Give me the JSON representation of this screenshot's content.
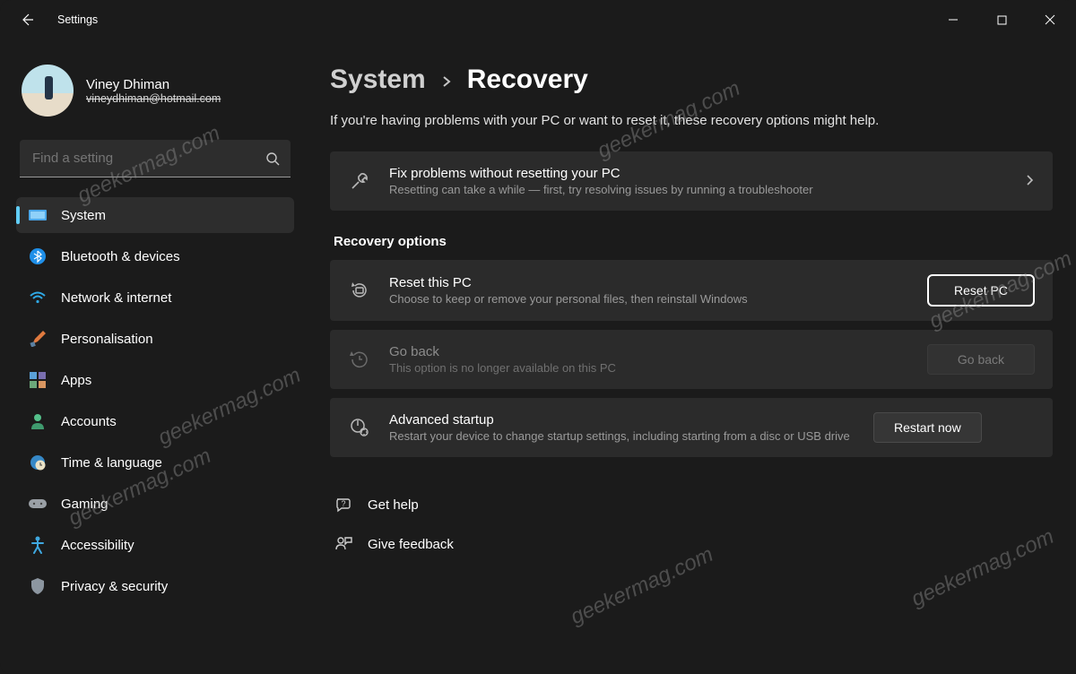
{
  "window": {
    "title": "Settings"
  },
  "profile": {
    "name": "Viney Dhiman",
    "email": "vineydhiman@hotmail.com"
  },
  "search": {
    "placeholder": "Find a setting"
  },
  "sidebar": {
    "items": [
      {
        "id": "system",
        "label": "System",
        "active": true
      },
      {
        "id": "bluetooth",
        "label": "Bluetooth & devices",
        "active": false
      },
      {
        "id": "network",
        "label": "Network & internet",
        "active": false
      },
      {
        "id": "personal",
        "label": "Personalisation",
        "active": false
      },
      {
        "id": "apps",
        "label": "Apps",
        "active": false
      },
      {
        "id": "accounts",
        "label": "Accounts",
        "active": false
      },
      {
        "id": "time",
        "label": "Time & language",
        "active": false
      },
      {
        "id": "gaming",
        "label": "Gaming",
        "active": false
      },
      {
        "id": "accessibility",
        "label": "Accessibility",
        "active": false
      },
      {
        "id": "privacy",
        "label": "Privacy & security",
        "active": false
      }
    ]
  },
  "breadcrumb": {
    "parent": "System",
    "current": "Recovery"
  },
  "page_desc": "If you're having problems with your PC or want to reset it, these recovery options might help.",
  "cards": {
    "troubleshoot": {
      "title": "Fix problems without resetting your PC",
      "desc": "Resetting can take a while — first, try resolving issues by running a troubleshooter"
    }
  },
  "section_heading": "Recovery options",
  "recovery": {
    "reset": {
      "title": "Reset this PC",
      "desc": "Choose to keep or remove your personal files, then reinstall Windows",
      "button": "Reset PC"
    },
    "goback": {
      "title": "Go back",
      "desc": "This option is no longer available on this PC",
      "button": "Go back"
    },
    "advanced": {
      "title": "Advanced startup",
      "desc": "Restart your device to change startup settings, including starting from a disc or USB drive",
      "button": "Restart now"
    }
  },
  "links": {
    "help": "Get help",
    "feedback": "Give feedback"
  },
  "watermark": "geekermag.com"
}
